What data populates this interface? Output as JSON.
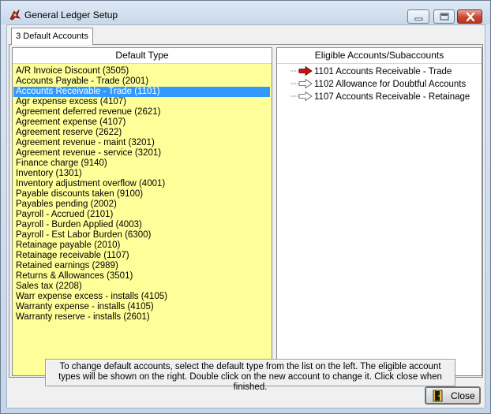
{
  "window": {
    "title": "General Ledger Setup",
    "icon": "gl-setup-icon"
  },
  "tabs": [
    {
      "label": "3 Default Accounts",
      "active": true
    }
  ],
  "default_type": {
    "header": "Default Type",
    "selected_index": 2,
    "items": [
      "A/R Invoice Discount (3505)",
      "Accounts Payable - Trade (2001)",
      "Accounts Receivable - Trade (1101)",
      "Agr expense excess (4107)",
      "Agreement deferred revenue (2621)",
      "Agreement expense (4107)",
      "Agreement reserve (2622)",
      "Agreement revenue - maint (3201)",
      "Agreement revenue - service (3201)",
      "Finance charge (9140)",
      "Inventory (1301)",
      "Inventory adjustment overflow (4001)",
      "Payable discounts taken (9100)",
      "Payables pending (2002)",
      "Payroll - Accrued (2101)",
      "Payroll - Burden Applied (4003)",
      "Payroll - Est Labor Burden (6300)",
      "Retainage payable (2010)",
      "Retainage receivable (1107)",
      "Retained earnings (2989)",
      "Returns & Allowances (3501)",
      "Sales tax (2208)",
      "Warr expense excess - installs (4105)",
      "Warranty expense - installs (4105)",
      "Warranty reserve - installs (2601)"
    ]
  },
  "eligible_accounts": {
    "header": "Eligible Accounts/Subaccounts",
    "items": [
      {
        "label": "1101 Accounts Receivable - Trade",
        "active": true,
        "icon": "red-arrow-icon"
      },
      {
        "label": "1102 Allowance for Doubtful Accounts",
        "active": false,
        "icon": "outline-arrow-icon"
      },
      {
        "label": "1107 Accounts Receivable - Retainage",
        "active": false,
        "icon": "outline-arrow-icon"
      }
    ]
  },
  "instructions": "To change default accounts, select the default type from the list on the left. The eligible account types will be shown on the right.  Double click on the new account to change it. Click close when finished.",
  "buttons": {
    "close_label": "Close"
  },
  "colors": {
    "list_background": "#ffff99",
    "selection": "#3399ff",
    "active_arrow": "#cc1111"
  }
}
